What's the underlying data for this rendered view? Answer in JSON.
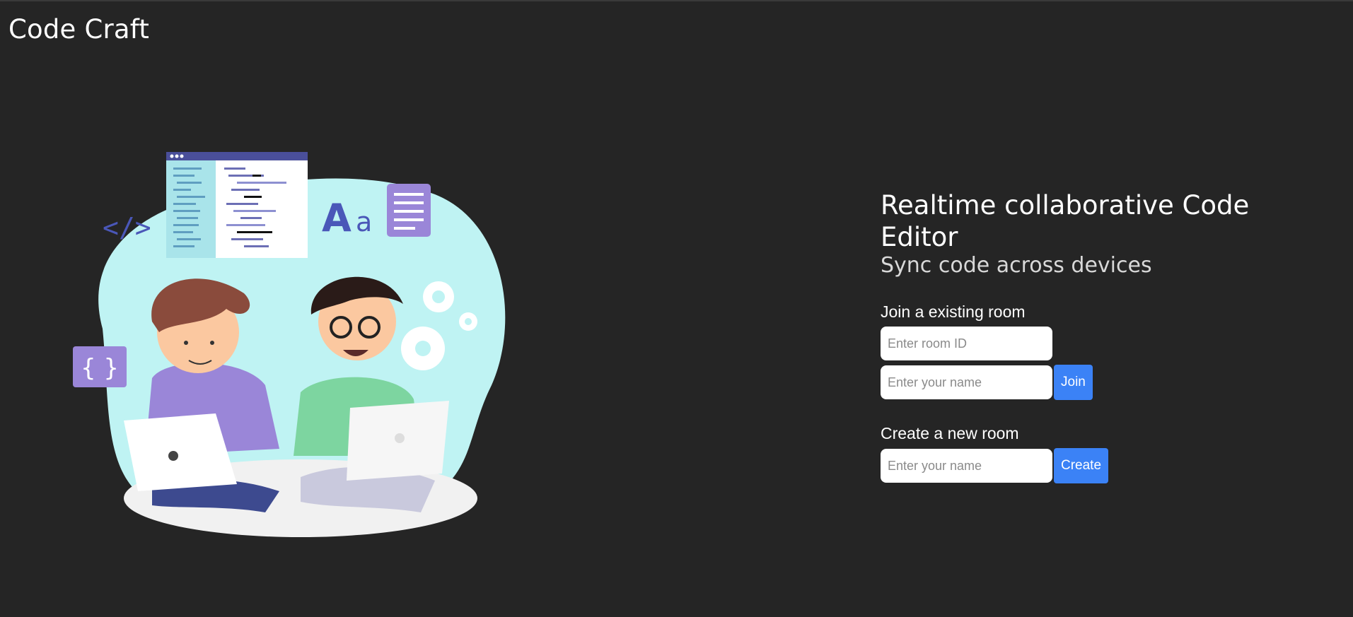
{
  "app": {
    "title": "Code Craft"
  },
  "hero": {
    "headline": "Realtime collaborative Code Editor",
    "subheadline": "Sync code across devices"
  },
  "join": {
    "title": "Join a existing room",
    "room_id_placeholder": "Enter room ID",
    "name_placeholder": "Enter your name",
    "button_label": "Join"
  },
  "create": {
    "title": "Create a new room",
    "name_placeholder": "Enter your name",
    "button_label": "Create"
  },
  "illustration": {
    "glyph_code": "</>",
    "glyph_braces": "{ }",
    "glyph_font": "Aa"
  },
  "colors": {
    "background": "#252525",
    "accent": "#3b82f6",
    "blob": "#bff3f3",
    "purple": "#9a86d8"
  }
}
